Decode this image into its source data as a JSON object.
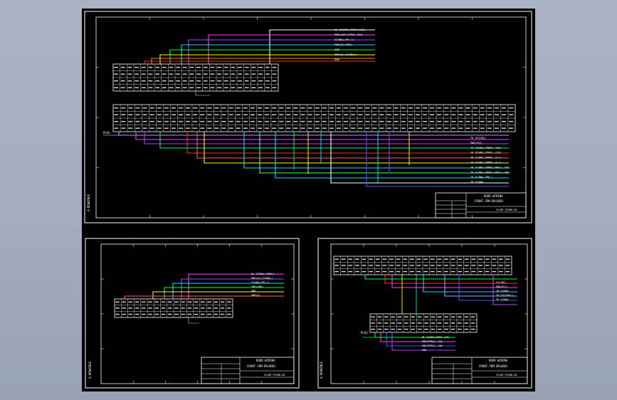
{
  "colors": {
    "viewport_bg": "#a3adbf",
    "canvas_bg": "#000000",
    "frame": "#ffffff",
    "wire_palette": [
      "#ff2a2a",
      "#ff8c00",
      "#ffff00",
      "#00ff3a",
      "#00e0ff",
      "#3a5bff",
      "#b040ff",
      "#ff40ff",
      "#a0a0ff",
      "#ffffff",
      "#3aff9a",
      "#ff6060"
    ]
  },
  "sheets": [
    {
      "id": "top",
      "title_block": {
        "line1": "DOOR WIRING",
        "line2": "FRONT-FRM-DR(WSD)",
        "code": "5110P-PSZHB-00"
      },
      "upper_labels": [
        "WL SIGNAL(PRES.LS0)",
        "PWR(ANT)PPRSL-510",
        "SIGNAL(PR-1)",
        "PWR(D)(GND)",
        "GND",
        "PWR(D)(SIGNAL)",
        "GND"
      ],
      "right_labels": [
        "TR SIG(RD)",
        "PWR(PLE)",
        "TR SIGNAL(PWRSL-310)",
        "TR SIGNAL(PPRSL-310)",
        "TR SIGNAL(PPRSL-311)",
        "TR SIGNAL(PPRSL-3L1)",
        "TR SIGNAL(PPRSL(PRSL)-100)",
        "TR SIGNAL(PPRSL(PRSL)-300)",
        "TR SIGNAL(PRL)",
        "TR SIGNAL"
      ],
      "side_note": "A-DRAWINGS",
      "left_tag": "PLUG"
    },
    {
      "id": "bottom-left",
      "title_block": {
        "line1": "DOOR WIRING",
        "line2": "FRONT-FRM-DR(WSD)",
        "code": "5110P-PSZHB-00"
      },
      "upper_labels": [
        "WL SIGNAL(PRES)",
        "PWR(D)(SIGNAL)",
        "SIGNAL(PR-1)",
        "PWR(GND)",
        "GND",
        "PWR(D)"
      ],
      "side_note": "A-DRAWINGS"
    },
    {
      "id": "bottom-right",
      "title_block": {
        "line1": "DOOR WIRING",
        "line2": "FRONT-FRM-DR(WSD)",
        "code": "5110P-PSZHB-00"
      },
      "right_labels": [
        "SIG(RD)",
        "PWR(PLE)",
        "TR SIGNAL",
        "TR SIG(PRSL)",
        "TR SIGNAL"
      ],
      "lower_labels": [
        "WL SIGNAL(PRES.LS0)",
        "PWR(PPRSL)-310",
        "PWR(PPRSL)-100",
        "GND"
      ],
      "side_note": "A-DRAWINGS",
      "left_tag": "PLUG"
    }
  ]
}
